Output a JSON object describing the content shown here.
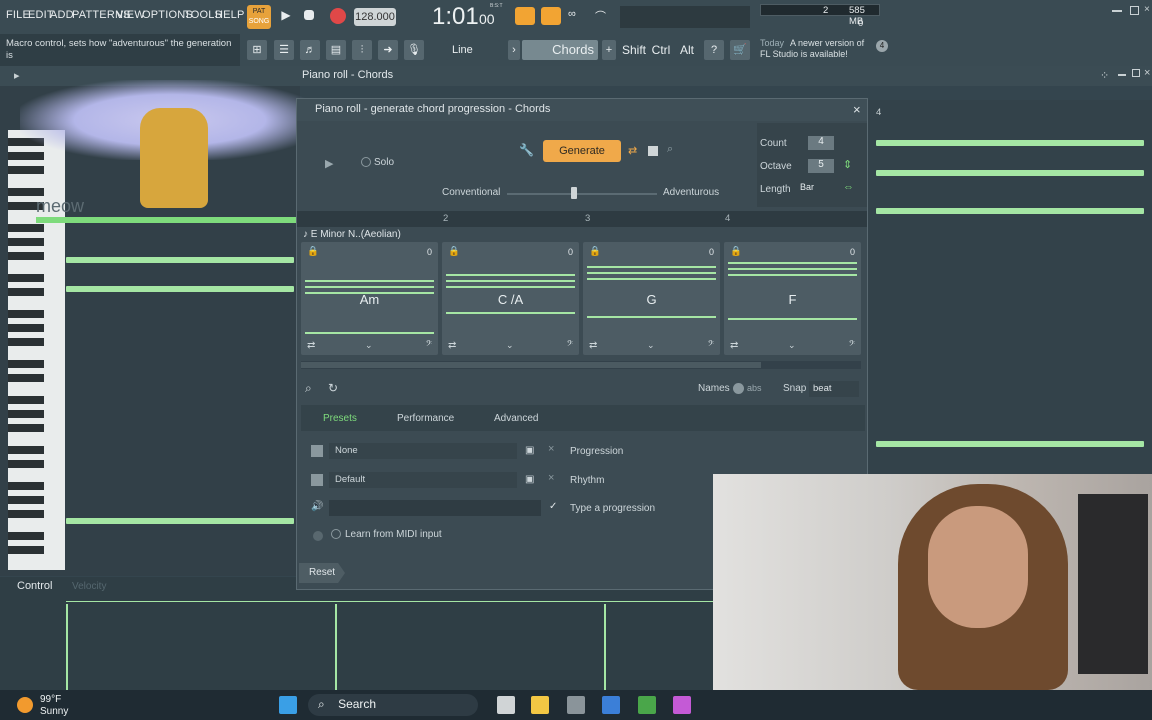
{
  "menu": {
    "items": [
      "FILE",
      "EDIT",
      "ADD",
      "PATTERNS",
      "VIEW",
      "OPTIONS",
      "TOOLS",
      "HELP"
    ],
    "pat_label": "PAT",
    "song_label": "SONG",
    "tempo": "128.000",
    "time": "1:01",
    "time_frac": "00",
    "time_sig_label": "B:S:T",
    "cpu_value": "2",
    "mem_value": "585 MB",
    "poly_value": "0"
  },
  "hint": {
    "text": "Macro control, sets how \"adventurous\" the generation is"
  },
  "toolbar2": {
    "line_label": "Line",
    "chords_label": "Chords",
    "shift_label": "Shift",
    "ctrl_label": "Ctrl",
    "alt_label": "Alt",
    "news_day": "Today",
    "news_text": "A newer version of FL Studio is available!",
    "news_count": "4"
  },
  "pianoroll": {
    "title": "Piano roll - Chords",
    "overlay_text": "meow",
    "control_label": "Control",
    "velocity_label": "Velocity"
  },
  "dialog": {
    "title": "Piano roll - generate chord progression - Chords",
    "solo_label": "Solo",
    "generate_label": "Generate",
    "conventional_label": "Conventional",
    "adventurous_label": "Adventurous",
    "count_label": "Count",
    "count_value": "4",
    "octave_label": "Octave",
    "octave_value": "5",
    "length_label": "Length",
    "length_value": "Bar",
    "scale_label": "E Minor N..(Aeolian)",
    "ruler": [
      "2",
      "3",
      "4"
    ],
    "chords": [
      {
        "name": "Am",
        "count": "0"
      },
      {
        "name": "C /A",
        "count": "0"
      },
      {
        "name": "G",
        "count": "0"
      },
      {
        "name": "F",
        "count": "0"
      }
    ],
    "names_label": "Names",
    "abs_label": "abs",
    "snap_label": "Snap",
    "snap_value": "beat",
    "tabs": [
      "Presets",
      "Performance",
      "Advanced"
    ],
    "progression_value": "None",
    "progression_label": "Progression",
    "rhythm_value": "Default",
    "rhythm_label": "Rhythm",
    "type_label": "Type a progression",
    "midi_label": "Learn from MIDI input",
    "reset_label": "Reset"
  },
  "rightgrid": {
    "bar_label": "4"
  },
  "taskbar": {
    "temp": "99°F",
    "weather": "Sunny",
    "search_label": "Search"
  },
  "colors": {
    "note": "#a5e6a4",
    "generate": "#f0a94a",
    "accent_orange": "#f2a433"
  }
}
